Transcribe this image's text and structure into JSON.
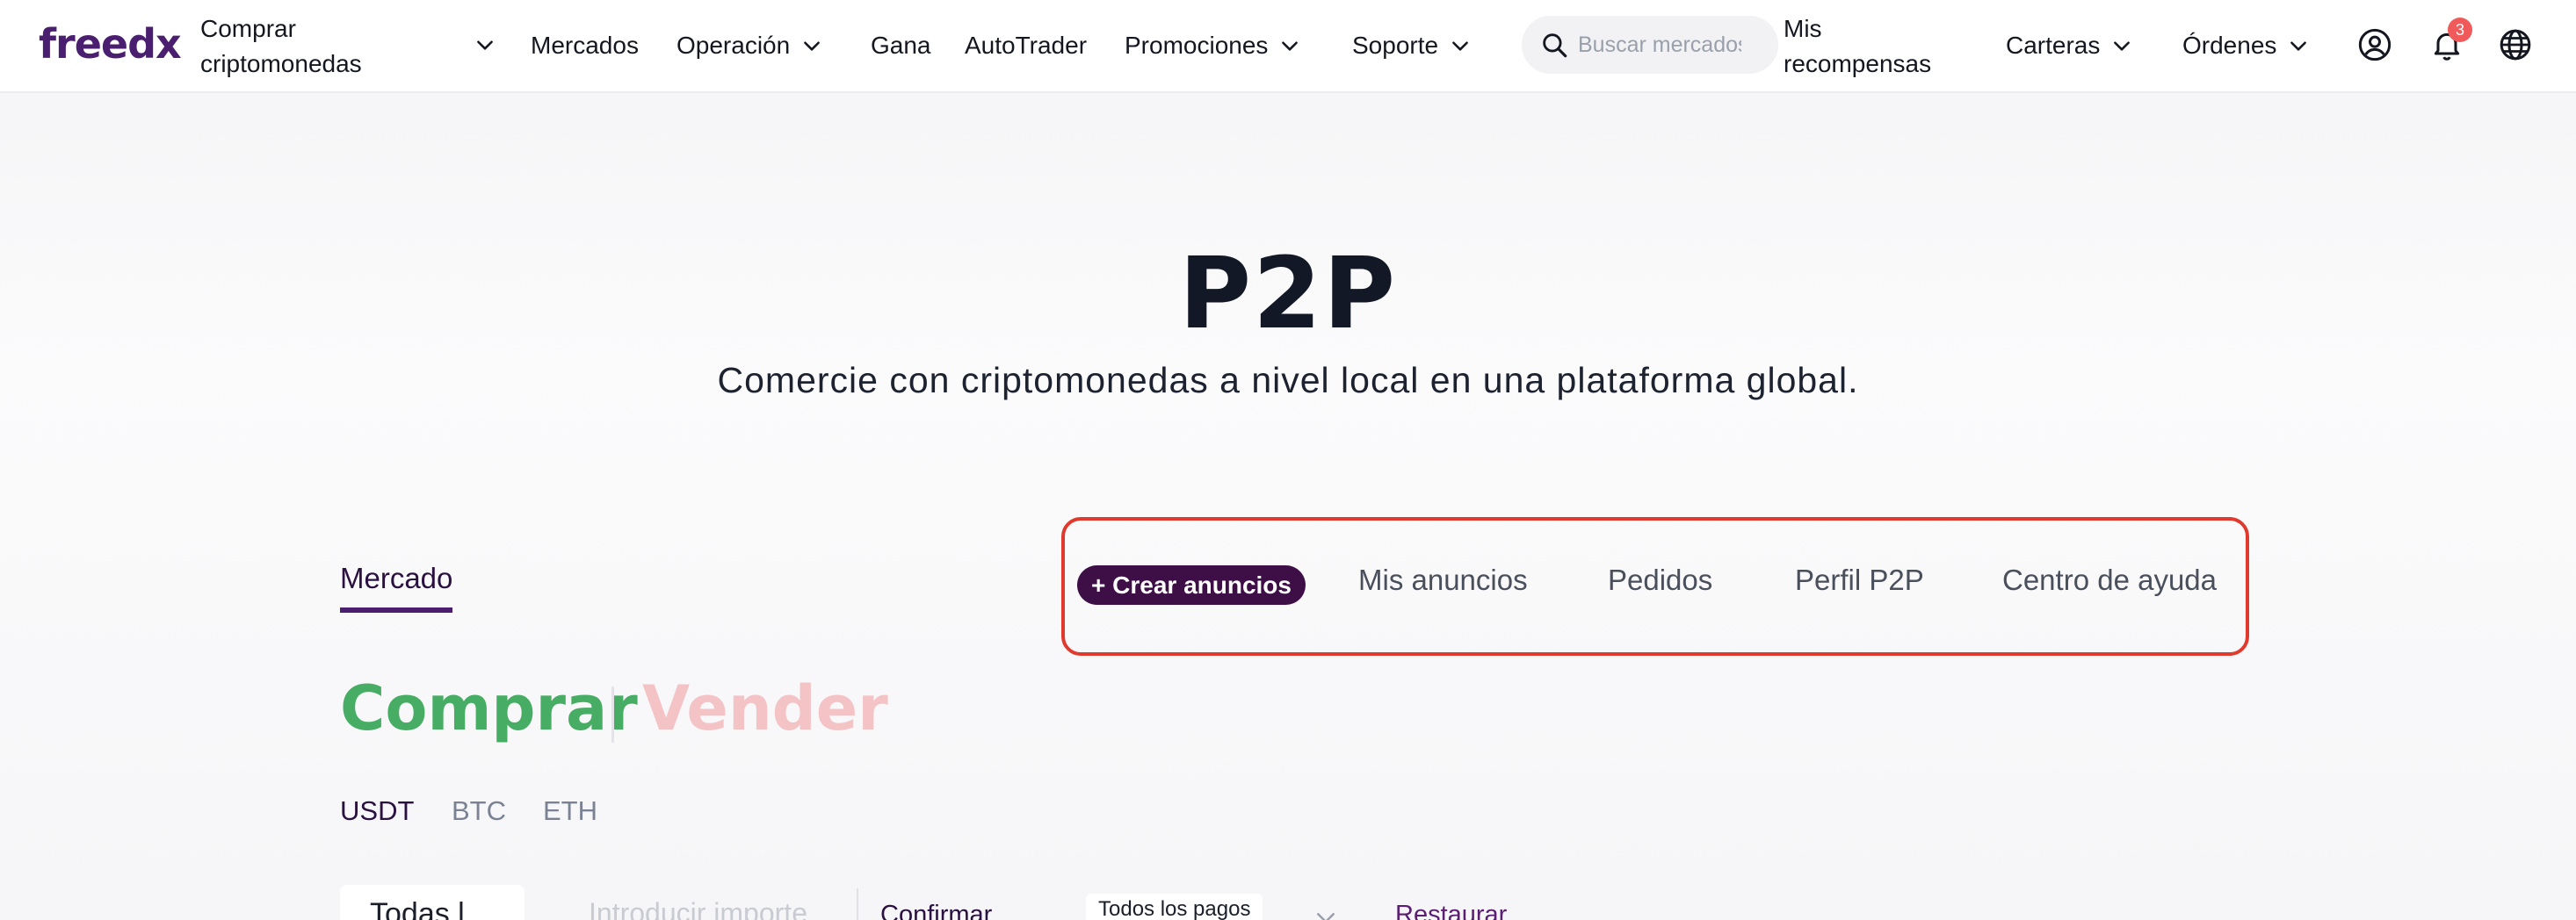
{
  "brand": {
    "logo_text": "freedx",
    "color": "#4b1f6f"
  },
  "nav": {
    "buy_crypto": "Comprar criptomonedas",
    "markets": "Mercados",
    "trading": "Operación",
    "earn": "Gana",
    "autotrader": "AutoTrader",
    "promotions": "Promociones",
    "support": "Soporte",
    "search_placeholder": "Buscar mercados",
    "rewards": "Mis recompensas",
    "wallets": "Carteras",
    "orders": "Órdenes",
    "notifications_count": "3"
  },
  "hero": {
    "title": "P2P",
    "subtitle": "Comercie con criptomonedas a nivel local en una plataforma global."
  },
  "tabs": {
    "market": "Mercado",
    "create_ads": "+ Crear anuncios",
    "my_ads": "Mis anuncios",
    "orders": "Pedidos",
    "profile": "Perfil P2P",
    "help": "Centro de ayuda"
  },
  "trade": {
    "buy": "Comprar",
    "sell": "Vender",
    "buy_color": "#47ad64",
    "sell_color": "#f3c3c6"
  },
  "coins": [
    "USDT",
    "BTC",
    "ETH"
  ],
  "filters": {
    "currency_select": "Todas l",
    "amount_placeholder": "Introducir importe",
    "confirm": "Confirmar",
    "payment_select": "Todos los pagos",
    "reset": "Restaurar"
  },
  "colors": {
    "accent": "#4b1f6f",
    "highlight_border": "#e03a2f",
    "create_button_bg": "#3e0f47"
  }
}
